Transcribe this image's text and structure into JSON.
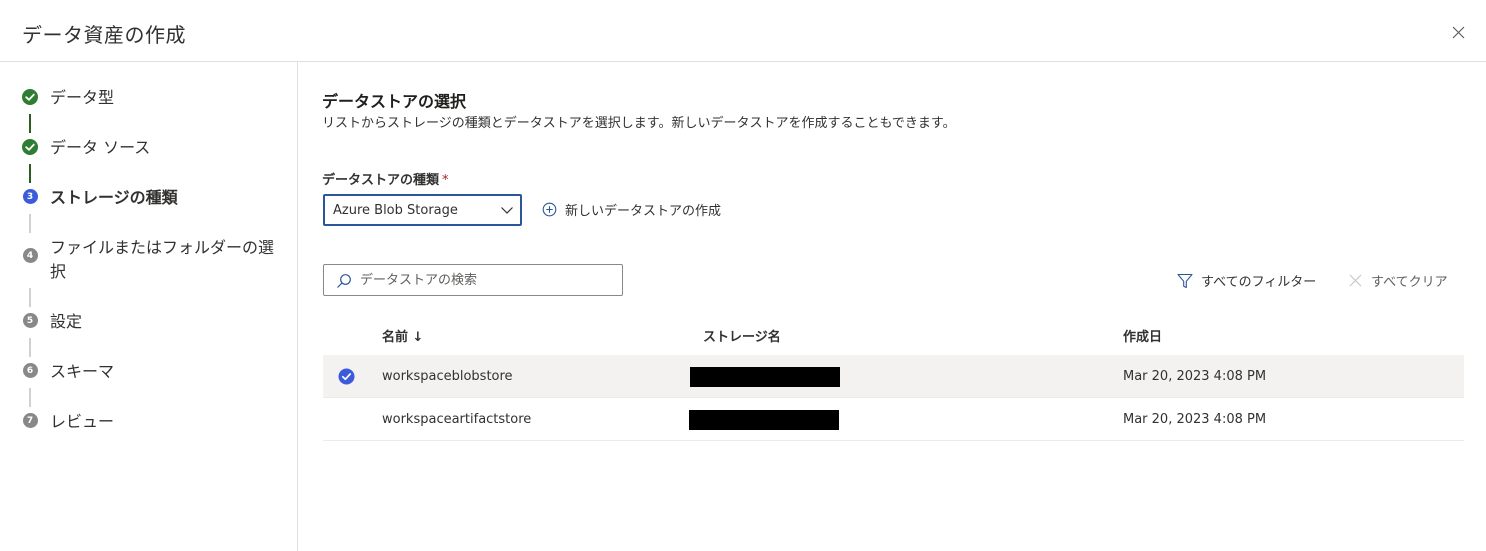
{
  "header": {
    "title": "データ資産の作成"
  },
  "steps": [
    {
      "label": "データ型",
      "status": "done",
      "num": ""
    },
    {
      "label": "データ ソース",
      "status": "done",
      "num": ""
    },
    {
      "label": "ストレージの種類",
      "status": "current",
      "num": "3"
    },
    {
      "label": "ファイルまたはフォルダーの選択",
      "status": "pending",
      "num": "4"
    },
    {
      "label": "設定",
      "status": "pending",
      "num": "5"
    },
    {
      "label": "スキーマ",
      "status": "pending",
      "num": "6"
    },
    {
      "label": "レビュー",
      "status": "pending",
      "num": "7"
    }
  ],
  "main": {
    "title": "データストアの選択",
    "description": "リストからストレージの種類とデータストアを選択します。新しいデータストアを作成することもできます。",
    "datastore_type": {
      "label": "データストアの種類",
      "required_mark": "*",
      "value": "Azure Blob Storage"
    },
    "new_datastore_label": "新しいデータストアの作成",
    "search": {
      "placeholder": "データストアの検索",
      "value": ""
    },
    "filter_all_label": "すべてのフィルター",
    "clear_all_label": "すべてクリア"
  },
  "table": {
    "columns": {
      "name": "名前 ↓",
      "storage": "ストレージ名",
      "created": "作成日"
    },
    "rows": [
      {
        "name": "workspaceblobstore",
        "storage": "",
        "created": "Mar 20, 2023 4:08 PM",
        "selected": true
      },
      {
        "name": "workspaceartifactstore",
        "storage": "",
        "created": "Mar 20, 2023 4:08 PM",
        "selected": false
      }
    ]
  },
  "colors": {
    "accent": "#3b5bdb",
    "done": "#2e7d32",
    "border": "#e1dfdd",
    "selected_row": "#f3f2f1"
  },
  "icons": [
    "close-icon",
    "check-circle-icon",
    "chevron-down-icon",
    "add-circle-icon",
    "search-icon",
    "filter-icon",
    "clear-icon"
  ]
}
